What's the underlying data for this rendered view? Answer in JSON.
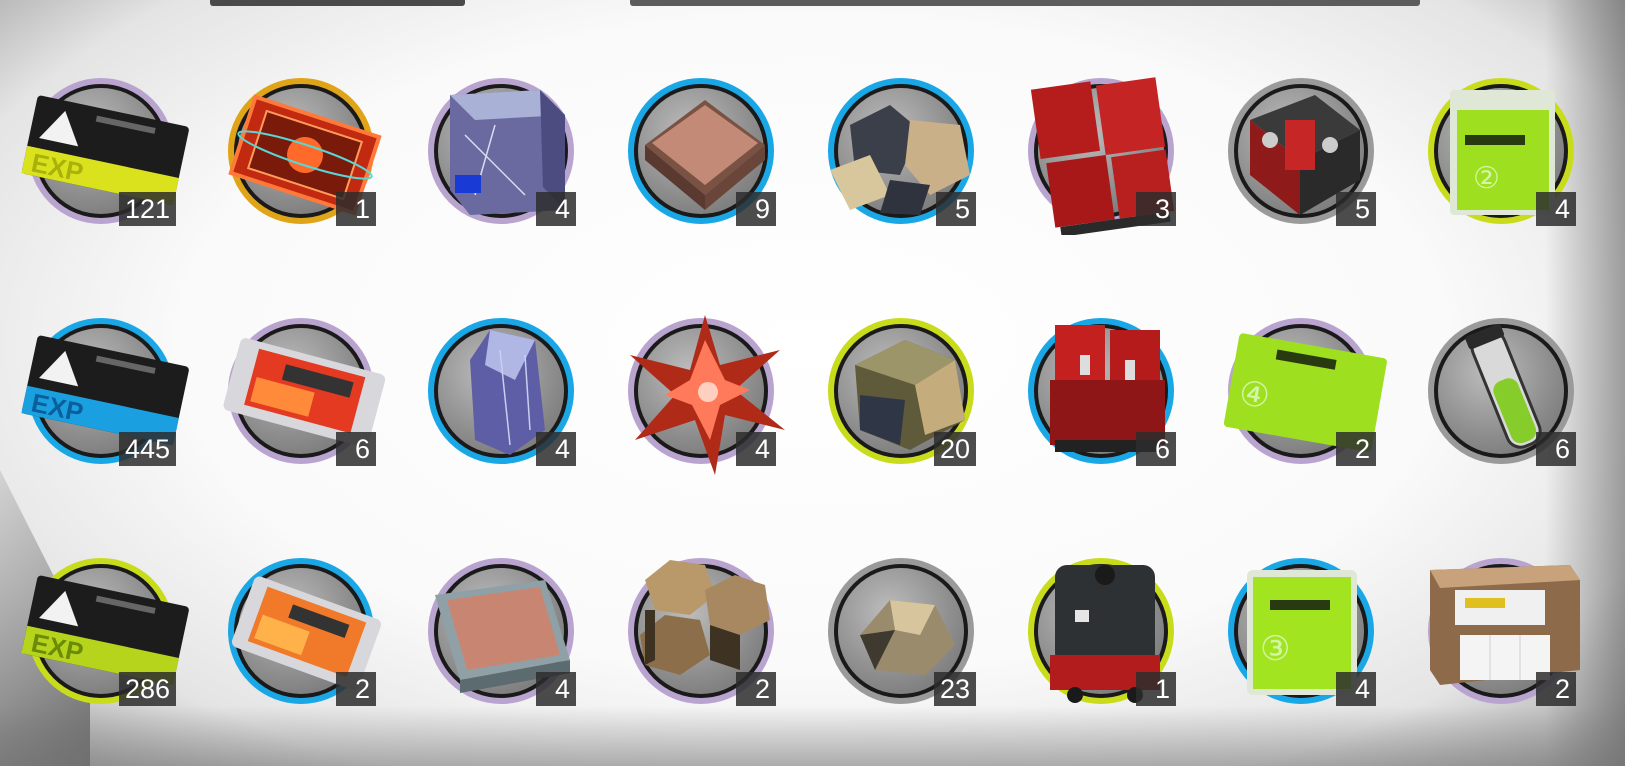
{
  "rarity_colors": {
    "purple": "#b9a4cf",
    "blue": "#1aa7e6",
    "gold": "#e0a418",
    "yellow": "#c8dc1c",
    "gray": "#9a9a9a"
  },
  "items": [
    {
      "name": "exp-card-yellow",
      "rarity": "purple",
      "count": "121"
    },
    {
      "name": "red-circuit-frame",
      "rarity": "gold",
      "count": "1"
    },
    {
      "name": "purple-crystal-cube",
      "rarity": "purple",
      "count": "4"
    },
    {
      "name": "copper-plate",
      "rarity": "blue",
      "count": "9"
    },
    {
      "name": "ore-chunks",
      "rarity": "blue",
      "count": "5"
    },
    {
      "name": "red-device-cluster",
      "rarity": "purple",
      "count": "3"
    },
    {
      "name": "red-valve-device",
      "rarity": "gray",
      "count": "5"
    },
    {
      "name": "green-pack-2",
      "rarity": "yellow",
      "count": "4"
    },
    {
      "name": "exp-card-blue",
      "rarity": "blue",
      "count": "445"
    },
    {
      "name": "red-snack-pack",
      "rarity": "purple",
      "count": "6"
    },
    {
      "name": "purple-crystal-shard",
      "rarity": "blue",
      "count": "4"
    },
    {
      "name": "red-crystal-star",
      "rarity": "purple",
      "count": "4"
    },
    {
      "name": "gold-ore-chunk",
      "rarity": "yellow",
      "count": "20"
    },
    {
      "name": "red-twin-device",
      "rarity": "blue",
      "count": "6"
    },
    {
      "name": "green-pack-4",
      "rarity": "purple",
      "count": "2"
    },
    {
      "name": "green-vial",
      "rarity": "gray",
      "count": "6"
    },
    {
      "name": "exp-card-green",
      "rarity": "yellow",
      "count": "286"
    },
    {
      "name": "orange-snack-pack",
      "rarity": "blue",
      "count": "2"
    },
    {
      "name": "copper-tray",
      "rarity": "purple",
      "count": "4"
    },
    {
      "name": "hex-blocks",
      "rarity": "purple",
      "count": "2"
    },
    {
      "name": "raw-ore",
      "rarity": "gray",
      "count": "23"
    },
    {
      "name": "black-red-device",
      "rarity": "yellow",
      "count": "1"
    },
    {
      "name": "green-pack-3",
      "rarity": "blue",
      "count": "4"
    },
    {
      "name": "supply-box",
      "rarity": "purple",
      "count": "2"
    }
  ]
}
